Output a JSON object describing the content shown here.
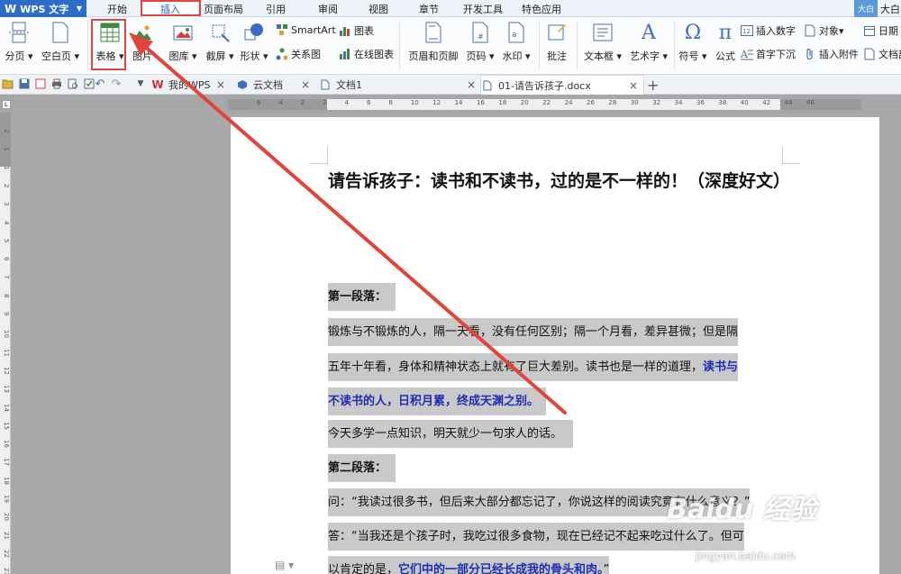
{
  "app": {
    "name": "WPS 文字"
  },
  "tabs": [
    {
      "label": "开始"
    },
    {
      "label": "插入",
      "active": true
    },
    {
      "label": "页面布局"
    },
    {
      "label": "引用"
    },
    {
      "label": "审阅"
    },
    {
      "label": "视图"
    },
    {
      "label": "章节"
    },
    {
      "label": "开发工具"
    },
    {
      "label": "特色应用"
    }
  ],
  "user": {
    "badge": "大白",
    "name": "大白"
  },
  "ribbon": {
    "page_break": "分页",
    "blank_page": "空白页",
    "table": "表格",
    "picture": "图片",
    "gallery": "图库",
    "screenshot": "截屏",
    "shapes": "形状",
    "smartart": "SmartArt",
    "chart": "图表",
    "relation": "关系图",
    "online_chart": "在线图表",
    "header_footer": "页眉和页脚",
    "page_number": "页码",
    "watermark": "水印",
    "comment": "批注",
    "textbox": "文本框",
    "wordart": "艺术字",
    "symbol": "符号",
    "formula": "公式",
    "insert_number": "插入数字",
    "object": "对象",
    "drop_cap": "首字下沉",
    "attachment": "插入附件",
    "date": "日期",
    "doc_parts": "文档部"
  },
  "doc_tabs": [
    {
      "label": "我的WPS"
    },
    {
      "label": "云文档"
    },
    {
      "label": "文档1"
    },
    {
      "label": "01-请告诉孩子.docx",
      "active": true
    }
  ],
  "ruler": {
    "h_numbers": [
      "6",
      "4",
      "2",
      "2",
      "4",
      "6",
      "8",
      "10",
      "12",
      "14",
      "16",
      "18",
      "20",
      "22",
      "24",
      "26",
      "28",
      "30",
      "32",
      "34",
      "36",
      "38",
      "40",
      "42",
      "44",
      "46"
    ],
    "v_numbers": [
      "2",
      "1",
      "1",
      "2",
      "3",
      "4",
      "5",
      "6",
      "7",
      "8",
      "9",
      "10",
      "11",
      "12",
      "13",
      "14",
      "15",
      "16",
      "17",
      "18",
      "19",
      "20",
      "21",
      "22",
      "23"
    ]
  },
  "document": {
    "title": "请告诉孩子：读书和不读书，过的是不一样的！（深度好文）",
    "p1_heading": "第一段落：",
    "p1_line1": "锻炼与不锻炼的人，隔一天看，没有任何区别；隔一个月看，差异甚微；但是隔",
    "p1_line2_normal": "五年十年看，身体和精神状态上就有了巨大差别。读书也是一样的道理，",
    "p1_line2_blue": "读书与",
    "p1_line3_blue": "不读书的人，日积月累，终成天渊之别。",
    "p1_line4": "今天多学一点知识，明天就少一句求人的话。",
    "p2_heading": "第二段落：",
    "p2_line1": "问：“我读过很多书，但后来大部分都忘记了，你说这样的阅读究竟有什么意义？”",
    "p2_line2": "答：“当我还是个孩子时，我吃过很多食物，现在已经记不起来吃过什么了。但可",
    "p2_line3_normal": "以肯定的是，",
    "p2_line3_blue": "它们中的一部分已经长成我的骨头和肉。",
    "p2_line3_end": "”"
  },
  "watermark": {
    "brand": "Baidu 经验",
    "url": "jingyan.baidu.com"
  },
  "colors": {
    "accent": "#2b6dc8",
    "highlight_box": "#e0443a",
    "blue_text": "#1f2eb0"
  }
}
